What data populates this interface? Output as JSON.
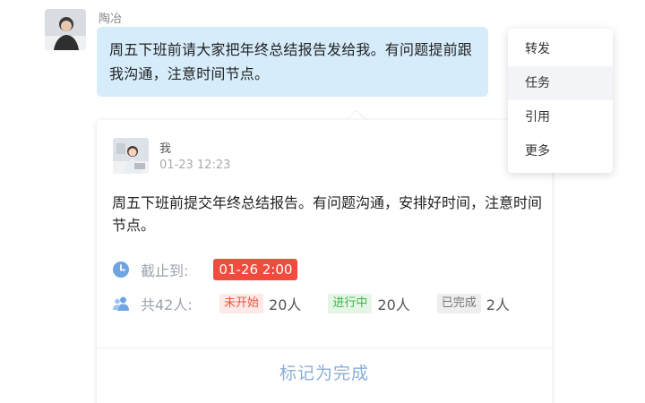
{
  "message": {
    "sender": "陶冶",
    "text": "周五下班前请大家把年终总结报告发给我。有问题提前跟我沟通，注意时间节点。"
  },
  "task_card": {
    "author": "我",
    "time": "01-23 12:23",
    "content": "周五下班前提交年终总结报告。有问题沟通，安排好时间，注意时间节点。",
    "deadline_label": "截止到:",
    "deadline_value": "01-26 2:00",
    "people_label": "共42人:",
    "statuses": [
      {
        "label": "未开始",
        "count": "20人"
      },
      {
        "label": "进行中",
        "count": "20人"
      },
      {
        "label": "已完成",
        "count": "2人"
      }
    ],
    "action_label": "标记为完成"
  },
  "context_menu": {
    "items": [
      "转发",
      "任务",
      "引用",
      "更多"
    ],
    "active_index": 1
  },
  "colors": {
    "bubble": "#d6ecfb",
    "deadline": "#f04b3d",
    "not_started": "#f0553f",
    "in_progress": "#3db449",
    "done": "#777777",
    "action": "#8aaed6",
    "icon": "#6fa5e3"
  },
  "icons": {
    "deadline": "clock-icon",
    "people": "people-icon"
  }
}
